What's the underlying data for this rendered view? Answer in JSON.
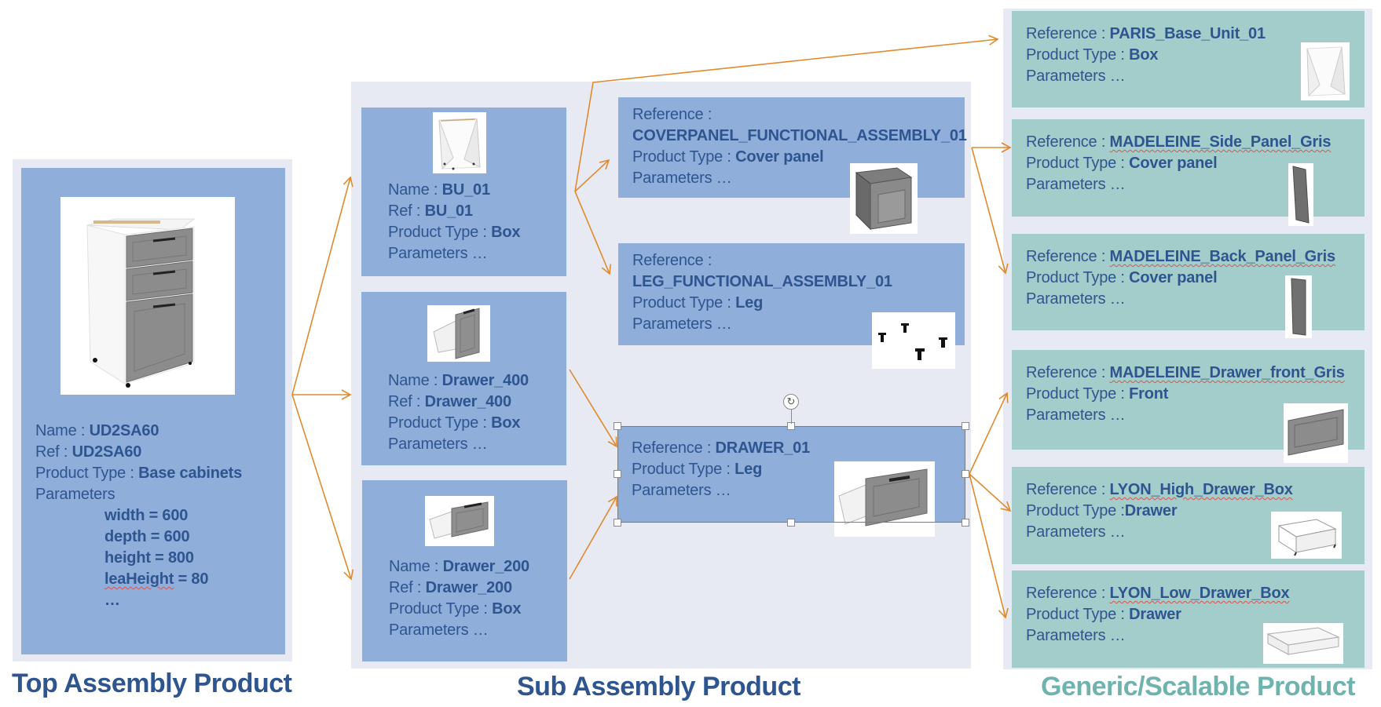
{
  "columns": {
    "top": {
      "title": "Top Assembly Product",
      "color": "#2f5590"
    },
    "sub": {
      "title": "Sub Assembly Product",
      "color": "#2f5590"
    },
    "generic": {
      "title": "Generic/Scalable Product",
      "color": "#6fb3ae"
    }
  },
  "labels": {
    "name": "Name : ",
    "ref": "Ref : ",
    "reference": "Reference : ",
    "product_type": "Product Type : ",
    "product_type_tight": "Product Type :",
    "parameters": "Parameters",
    "parameters_ellipsis": "Parameters …"
  },
  "top_product": {
    "name": "UD2SA60",
    "ref": "UD2SA60",
    "product_type": "Base cabinets",
    "image": "base-cabinet-3-drawers-image",
    "parameters": [
      {
        "key": "width",
        "value": "600",
        "text": "width = 600"
      },
      {
        "key": "depth",
        "value": "600",
        "text": "depth = 600"
      },
      {
        "key": "height",
        "value": "800",
        "text": "height = 800"
      },
      {
        "key": "legHeight",
        "value": "80",
        "text_key": "legHeight",
        "text_rest": " = 80",
        "display_key": "leaHeight"
      }
    ],
    "more": "…"
  },
  "sub_products": [
    {
      "name": "BU_01",
      "ref": "BU_01",
      "product_type": "Box",
      "image": "box-carcass-image"
    },
    {
      "name": "Drawer_400",
      "ref": "Drawer_400",
      "product_type": "Box",
      "image": "drawer-400-image"
    },
    {
      "name": "Drawer_200",
      "ref": "Drawer_200",
      "product_type": "Box",
      "image": "drawer-200-image"
    }
  ],
  "functional_assemblies": [
    {
      "reference": "COVERPANEL_FUNCTIONAL_ASSEMBLY_01",
      "product_type": "Cover panel",
      "image": "cover-panel-image"
    },
    {
      "reference": "LEG_FUNCTIONAL_ASSEMBLY_01",
      "product_type": "Leg",
      "image": "legs-image"
    },
    {
      "reference": "DRAWER_01",
      "product_type": "Leg",
      "image": "drawer-image",
      "selected": true
    }
  ],
  "generic_products": [
    {
      "reference": "PARIS_Base_Unit_01",
      "product_type": "Box",
      "image": "base-unit-image",
      "spellcheck": false
    },
    {
      "reference": "MADELEINE_Side_Panel_Gris",
      "product_type": "Cover panel",
      "image": "side-panel-image",
      "spellcheck": true
    },
    {
      "reference": "MADELEINE_Back_Panel_Gris",
      "product_type": "Cover panel",
      "image": "back-panel-image",
      "spellcheck": true
    },
    {
      "reference": "MADELEINE_Drawer_front_Gris",
      "product_type": "Front",
      "image": "drawer-front-image",
      "spellcheck": true
    },
    {
      "reference": "LYON_High_Drawer_Box",
      "product_type": "Drawer",
      "image": "high-drawer-box-image",
      "spellcheck": true,
      "tight_colon": true
    },
    {
      "reference": "LYON_Low_Drawer_Box",
      "product_type": "Drawer",
      "image": "low-drawer-box-image",
      "spellcheck": true
    }
  ],
  "style": {
    "box_blue": "#8faed9",
    "box_teal": "#a3cdcb",
    "panel_bg": "#e7eaf3",
    "text_color": "#2f5590",
    "arrow_color": "#e08a2e"
  }
}
